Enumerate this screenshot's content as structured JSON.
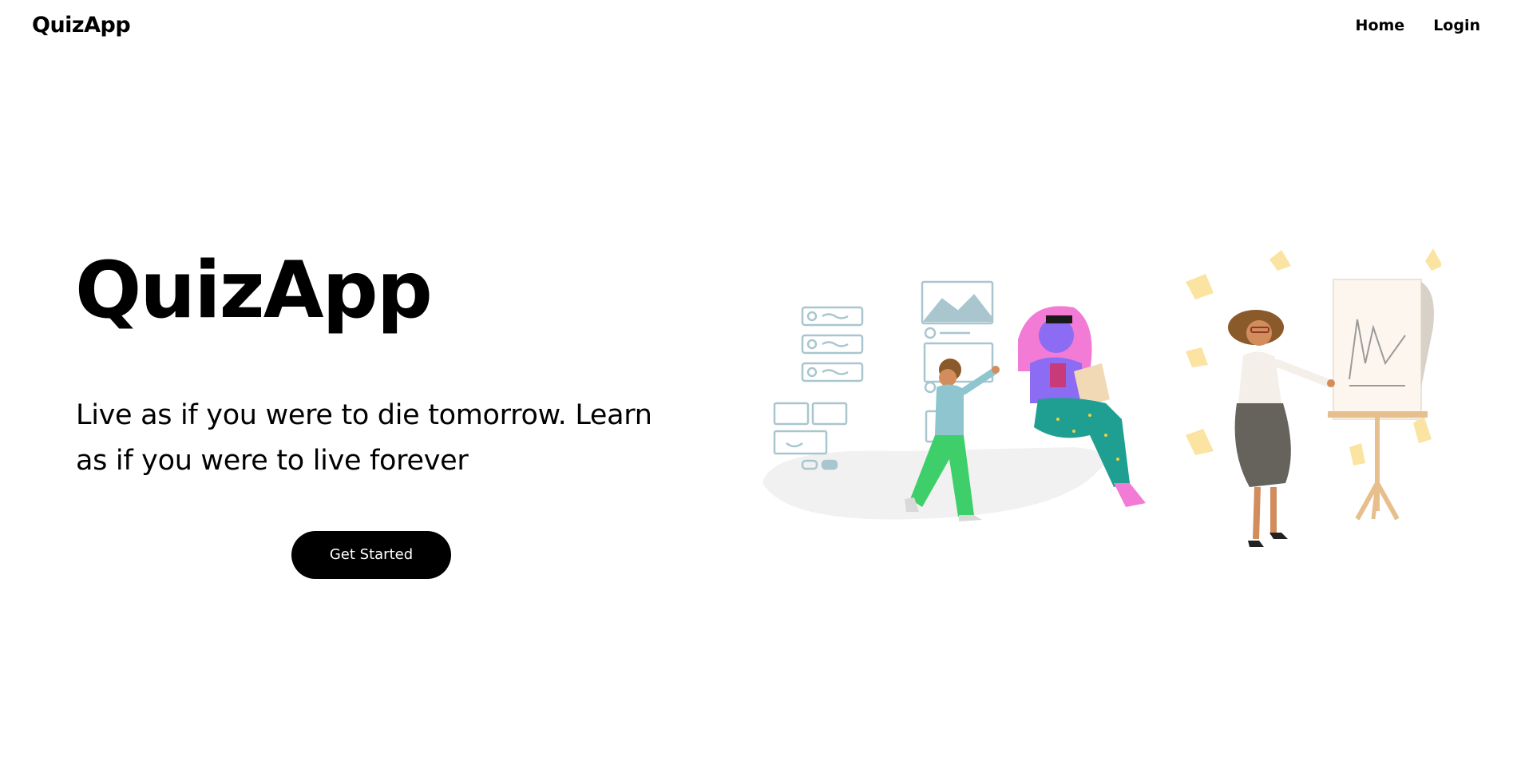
{
  "navbar": {
    "brand": "QuizApp",
    "links": [
      {
        "label": "Home"
      },
      {
        "label": "Login"
      }
    ]
  },
  "hero": {
    "title": "QuizApp",
    "quote": "Live as if you were to die tomorrow. Learn as if you were to live forever",
    "cta_label": "Get Started"
  },
  "illustration": {
    "name": "people-presenting-illustration",
    "colors": {
      "floor": "#f1f1f1",
      "wireframe": "#a9c6cf",
      "sticky_note": "#fbe3a1",
      "green": "#3fcf6a",
      "teal": "#1f9e92",
      "purple": "#8b6cf3",
      "pink": "#f27bd6",
      "skirt": "#66625c",
      "easel": "#e7bf8d",
      "skin": "#d38c5b"
    }
  }
}
